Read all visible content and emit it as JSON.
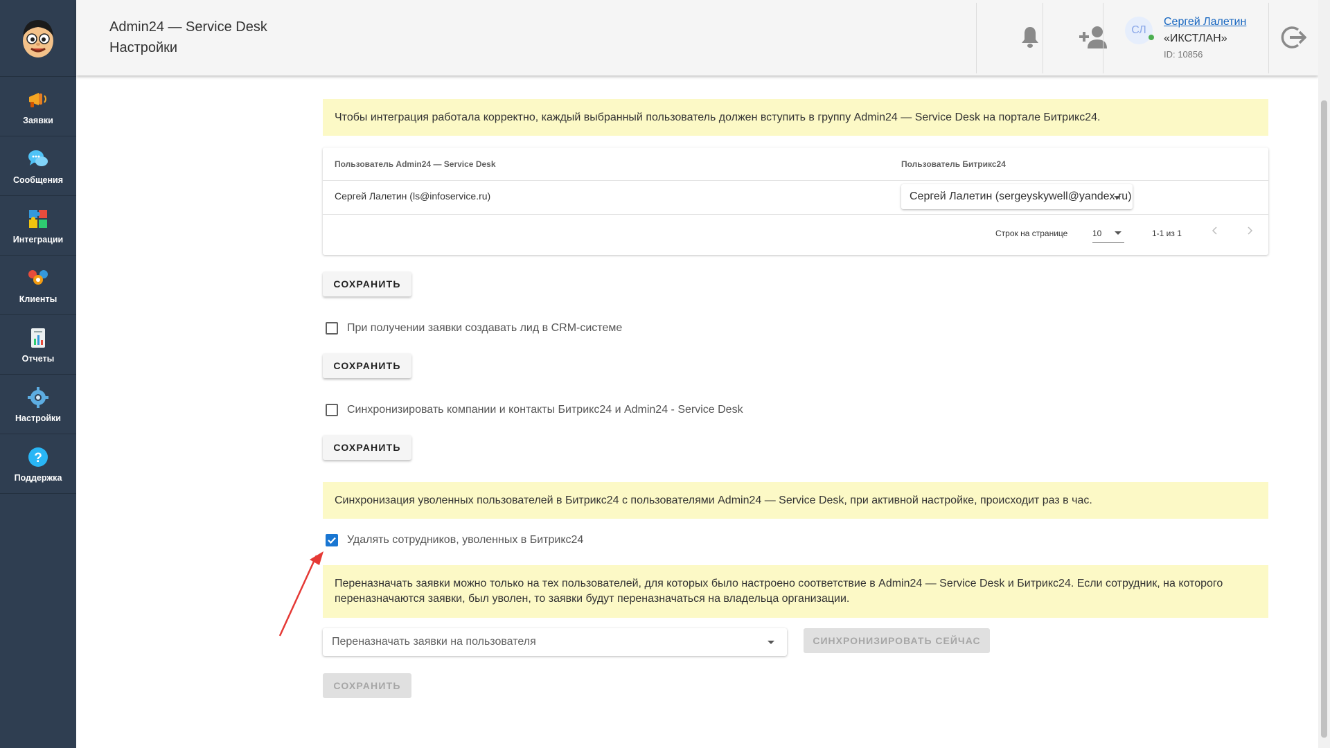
{
  "app": {
    "title": "Admin24 — Service Desk",
    "page_title": "Настройки"
  },
  "sidebar": {
    "items": [
      {
        "label": "Заявки",
        "icon": "megaphone-icon"
      },
      {
        "label": "Сообщения",
        "icon": "chat-bubbles-icon"
      },
      {
        "label": "Интеграции",
        "icon": "puzzle-icon"
      },
      {
        "label": "Клиенты",
        "icon": "people-icon"
      },
      {
        "label": "Отчеты",
        "icon": "report-icon"
      },
      {
        "label": "Настройки",
        "icon": "gear-icon"
      },
      {
        "label": "Поддержка",
        "icon": "help-icon"
      }
    ]
  },
  "header": {
    "user": {
      "initials": "СЛ",
      "name": "Сергей Лалетин",
      "org": "«ИКСТЛАН»",
      "id_text": "ID: 10856",
      "online": true
    }
  },
  "integration_notice": "Чтобы интеграция работала корректно, каждый выбранный пользователь должен вступить в группу Admin24 — Service Desk на портале Битрикс24.",
  "mapping_table": {
    "columns": [
      "Пользователь Admin24 — Service Desk",
      "Пользователь Битрикс24"
    ],
    "rows": [
      {
        "admin_user": "Сергей Лалетин (ls@infoservice.ru)",
        "bitrix_user": "Сергей Лалетин (sergeyskywell@yandex.ru)"
      }
    ],
    "pagination": {
      "rows_per_page_label": "Строк на странице",
      "rows_per_page": "10",
      "range": "1-1 из 1"
    }
  },
  "buttons": {
    "save": "СОХРАНИТЬ",
    "sync_now": "СИНХРОНИЗИРОВАТЬ СЕЙЧАС"
  },
  "options": {
    "create_lead": {
      "label": "При получении заявки создавать лид в CRM-системе",
      "checked": false
    },
    "sync_companies": {
      "label": "Синхронизировать компании и контакты Битрикс24 и Admin24 - Service Desk",
      "checked": false
    },
    "delete_fired": {
      "label": "Удалять сотрудников, уволенных в Битрикс24",
      "checked": true
    }
  },
  "sync_notice": "Синхронизация уволенных пользователей в Битрикс24 с пользователями Admin24 — Service Desk, при активной настройке, происходит раз в час.",
  "reassign_notice": "Переназначать заявки можно только на тех пользователей, для которых было настроено соответствие в Admin24 — Service Desk и Битрикс24. Если сотрудник, на которого переназначаются заявки, был уволен, то заявки будут переназначаться на владельца организации.",
  "reassign_select": {
    "placeholder": "Переназначать заявки на пользователя"
  },
  "colors": {
    "sidebar_bg": "#2f3e51",
    "notice_bg": "#fcf9c6",
    "accent": "#1976d2",
    "annotation_arrow": "#e53935"
  }
}
